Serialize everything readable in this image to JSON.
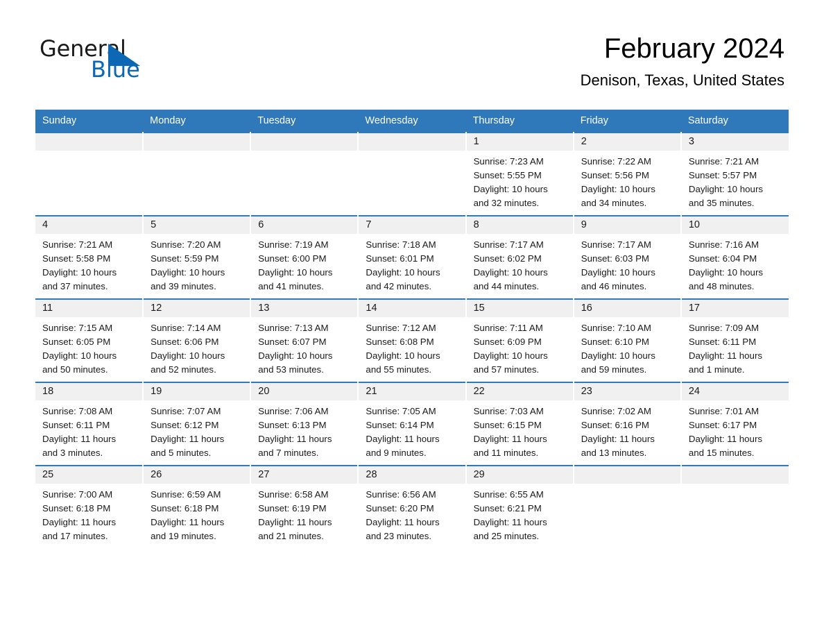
{
  "brand": {
    "logo_text_1": "General",
    "logo_text_2": "Blue",
    "logo_triangle_color": "#0c68b5",
    "accent_color": "#2f78b9"
  },
  "header": {
    "title": "February 2024",
    "subtitle": "Denison, Texas, United States"
  },
  "weekday_headers": [
    "Sunday",
    "Monday",
    "Tuesday",
    "Wednesday",
    "Thursday",
    "Friday",
    "Saturday"
  ],
  "labels": {
    "sunrise_prefix": "Sunrise:",
    "sunset_prefix": "Sunset:",
    "daylight_prefix": "Daylight:"
  },
  "weeks": [
    [
      {
        "day": "",
        "blank": true,
        "sunrise": "",
        "sunset": "",
        "daylight_1": "",
        "daylight_2": ""
      },
      {
        "day": "",
        "blank": true,
        "sunrise": "",
        "sunset": "",
        "daylight_1": "",
        "daylight_2": ""
      },
      {
        "day": "",
        "blank": true,
        "sunrise": "",
        "sunset": "",
        "daylight_1": "",
        "daylight_2": ""
      },
      {
        "day": "",
        "blank": true,
        "sunrise": "",
        "sunset": "",
        "daylight_1": "",
        "daylight_2": ""
      },
      {
        "day": "1",
        "blank": false,
        "sunrise": "Sunrise: 7:23 AM",
        "sunset": "Sunset: 5:55 PM",
        "daylight_1": "Daylight: 10 hours",
        "daylight_2": "and 32 minutes."
      },
      {
        "day": "2",
        "blank": false,
        "sunrise": "Sunrise: 7:22 AM",
        "sunset": "Sunset: 5:56 PM",
        "daylight_1": "Daylight: 10 hours",
        "daylight_2": "and 34 minutes."
      },
      {
        "day": "3",
        "blank": false,
        "sunrise": "Sunrise: 7:21 AM",
        "sunset": "Sunset: 5:57 PM",
        "daylight_1": "Daylight: 10 hours",
        "daylight_2": "and 35 minutes."
      }
    ],
    [
      {
        "day": "4",
        "blank": false,
        "sunrise": "Sunrise: 7:21 AM",
        "sunset": "Sunset: 5:58 PM",
        "daylight_1": "Daylight: 10 hours",
        "daylight_2": "and 37 minutes."
      },
      {
        "day": "5",
        "blank": false,
        "sunrise": "Sunrise: 7:20 AM",
        "sunset": "Sunset: 5:59 PM",
        "daylight_1": "Daylight: 10 hours",
        "daylight_2": "and 39 minutes."
      },
      {
        "day": "6",
        "blank": false,
        "sunrise": "Sunrise: 7:19 AM",
        "sunset": "Sunset: 6:00 PM",
        "daylight_1": "Daylight: 10 hours",
        "daylight_2": "and 41 minutes."
      },
      {
        "day": "7",
        "blank": false,
        "sunrise": "Sunrise: 7:18 AM",
        "sunset": "Sunset: 6:01 PM",
        "daylight_1": "Daylight: 10 hours",
        "daylight_2": "and 42 minutes."
      },
      {
        "day": "8",
        "blank": false,
        "sunrise": "Sunrise: 7:17 AM",
        "sunset": "Sunset: 6:02 PM",
        "daylight_1": "Daylight: 10 hours",
        "daylight_2": "and 44 minutes."
      },
      {
        "day": "9",
        "blank": false,
        "sunrise": "Sunrise: 7:17 AM",
        "sunset": "Sunset: 6:03 PM",
        "daylight_1": "Daylight: 10 hours",
        "daylight_2": "and 46 minutes."
      },
      {
        "day": "10",
        "blank": false,
        "sunrise": "Sunrise: 7:16 AM",
        "sunset": "Sunset: 6:04 PM",
        "daylight_1": "Daylight: 10 hours",
        "daylight_2": "and 48 minutes."
      }
    ],
    [
      {
        "day": "11",
        "blank": false,
        "sunrise": "Sunrise: 7:15 AM",
        "sunset": "Sunset: 6:05 PM",
        "daylight_1": "Daylight: 10 hours",
        "daylight_2": "and 50 minutes."
      },
      {
        "day": "12",
        "blank": false,
        "sunrise": "Sunrise: 7:14 AM",
        "sunset": "Sunset: 6:06 PM",
        "daylight_1": "Daylight: 10 hours",
        "daylight_2": "and 52 minutes."
      },
      {
        "day": "13",
        "blank": false,
        "sunrise": "Sunrise: 7:13 AM",
        "sunset": "Sunset: 6:07 PM",
        "daylight_1": "Daylight: 10 hours",
        "daylight_2": "and 53 minutes."
      },
      {
        "day": "14",
        "blank": false,
        "sunrise": "Sunrise: 7:12 AM",
        "sunset": "Sunset: 6:08 PM",
        "daylight_1": "Daylight: 10 hours",
        "daylight_2": "and 55 minutes."
      },
      {
        "day": "15",
        "blank": false,
        "sunrise": "Sunrise: 7:11 AM",
        "sunset": "Sunset: 6:09 PM",
        "daylight_1": "Daylight: 10 hours",
        "daylight_2": "and 57 minutes."
      },
      {
        "day": "16",
        "blank": false,
        "sunrise": "Sunrise: 7:10 AM",
        "sunset": "Sunset: 6:10 PM",
        "daylight_1": "Daylight: 10 hours",
        "daylight_2": "and 59 minutes."
      },
      {
        "day": "17",
        "blank": false,
        "sunrise": "Sunrise: 7:09 AM",
        "sunset": "Sunset: 6:11 PM",
        "daylight_1": "Daylight: 11 hours",
        "daylight_2": "and 1 minute."
      }
    ],
    [
      {
        "day": "18",
        "blank": false,
        "sunrise": "Sunrise: 7:08 AM",
        "sunset": "Sunset: 6:11 PM",
        "daylight_1": "Daylight: 11 hours",
        "daylight_2": "and 3 minutes."
      },
      {
        "day": "19",
        "blank": false,
        "sunrise": "Sunrise: 7:07 AM",
        "sunset": "Sunset: 6:12 PM",
        "daylight_1": "Daylight: 11 hours",
        "daylight_2": "and 5 minutes."
      },
      {
        "day": "20",
        "blank": false,
        "sunrise": "Sunrise: 7:06 AM",
        "sunset": "Sunset: 6:13 PM",
        "daylight_1": "Daylight: 11 hours",
        "daylight_2": "and 7 minutes."
      },
      {
        "day": "21",
        "blank": false,
        "sunrise": "Sunrise: 7:05 AM",
        "sunset": "Sunset: 6:14 PM",
        "daylight_1": "Daylight: 11 hours",
        "daylight_2": "and 9 minutes."
      },
      {
        "day": "22",
        "blank": false,
        "sunrise": "Sunrise: 7:03 AM",
        "sunset": "Sunset: 6:15 PM",
        "daylight_1": "Daylight: 11 hours",
        "daylight_2": "and 11 minutes."
      },
      {
        "day": "23",
        "blank": false,
        "sunrise": "Sunrise: 7:02 AM",
        "sunset": "Sunset: 6:16 PM",
        "daylight_1": "Daylight: 11 hours",
        "daylight_2": "and 13 minutes."
      },
      {
        "day": "24",
        "blank": false,
        "sunrise": "Sunrise: 7:01 AM",
        "sunset": "Sunset: 6:17 PM",
        "daylight_1": "Daylight: 11 hours",
        "daylight_2": "and 15 minutes."
      }
    ],
    [
      {
        "day": "25",
        "blank": false,
        "sunrise": "Sunrise: 7:00 AM",
        "sunset": "Sunset: 6:18 PM",
        "daylight_1": "Daylight: 11 hours",
        "daylight_2": "and 17 minutes."
      },
      {
        "day": "26",
        "blank": false,
        "sunrise": "Sunrise: 6:59 AM",
        "sunset": "Sunset: 6:18 PM",
        "daylight_1": "Daylight: 11 hours",
        "daylight_2": "and 19 minutes."
      },
      {
        "day": "27",
        "blank": false,
        "sunrise": "Sunrise: 6:58 AM",
        "sunset": "Sunset: 6:19 PM",
        "daylight_1": "Daylight: 11 hours",
        "daylight_2": "and 21 minutes."
      },
      {
        "day": "28",
        "blank": false,
        "sunrise": "Sunrise: 6:56 AM",
        "sunset": "Sunset: 6:20 PM",
        "daylight_1": "Daylight: 11 hours",
        "daylight_2": "and 23 minutes."
      },
      {
        "day": "29",
        "blank": false,
        "sunrise": "Sunrise: 6:55 AM",
        "sunset": "Sunset: 6:21 PM",
        "daylight_1": "Daylight: 11 hours",
        "daylight_2": "and 25 minutes."
      },
      {
        "day": "",
        "blank": true,
        "sunrise": "",
        "sunset": "",
        "daylight_1": "",
        "daylight_2": ""
      },
      {
        "day": "",
        "blank": true,
        "sunrise": "",
        "sunset": "",
        "daylight_1": "",
        "daylight_2": ""
      }
    ]
  ]
}
